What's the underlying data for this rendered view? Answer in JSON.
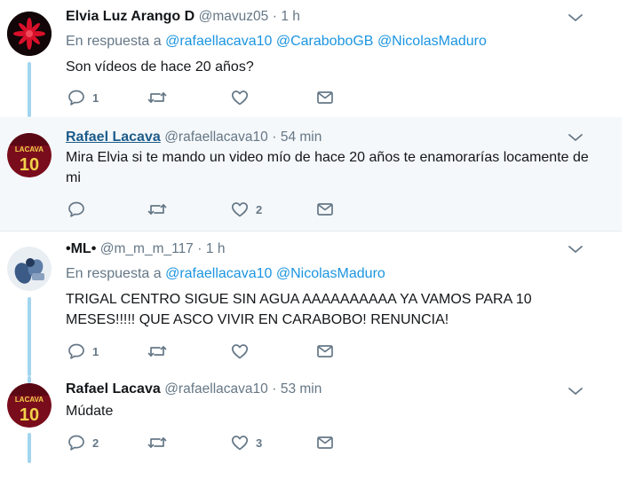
{
  "colors": {
    "mention": "#1b95e0",
    "muted": "#657786",
    "thread_line": "#a2d5ee",
    "highlight_bg": "#f5f8fa"
  },
  "tweets": [
    {
      "name": "Elvia Luz Arango D",
      "handle": "@mavuz05",
      "dot": "·",
      "time": "1 h",
      "reply_prefix": "En respuesta a",
      "mentions": [
        "@rafaellacava10",
        "@CaraboboGB",
        "@NicolasMaduro"
      ],
      "text": "Son vídeos de hace 20 años?",
      "reply_count": "1",
      "retweet_count": "",
      "like_count": "",
      "avatar_icon": "red-flower-avatar-icon"
    },
    {
      "name": "Rafael Lacava",
      "handle": "@rafaellacava10",
      "dot": "·",
      "time": "54 min",
      "text": "Mira Elvia si te mando un video mío de hace 20 años te enamorarías locamente de mi",
      "reply_count": "",
      "retweet_count": "",
      "like_count": "2",
      "avatar_jersey": {
        "label": "LACAVA",
        "number": "10"
      }
    },
    {
      "name": "•ML•",
      "handle": "@m_m_m_117",
      "dot": "·",
      "time": "1 h",
      "reply_prefix": "En respuesta a",
      "mentions": [
        "@rafaellacava10",
        "@NicolasMaduro"
      ],
      "text": "TRIGAL CENTRO SIGUE SIN AGUA AAAAAAAAAA YA VAMOS PARA 10 MESES!!!!! QUE ASCO VIVIR EN CARABOBO! RENUNCIA!",
      "reply_count": "1",
      "retweet_count": "",
      "like_count": "",
      "avatar_icon": "photo-avatar-icon"
    },
    {
      "name": "Rafael Lacava",
      "handle": "@rafaellacava10",
      "dot": "·",
      "time": "53 min",
      "text": "Múdate",
      "reply_count": "2",
      "retweet_count": "",
      "like_count": "3",
      "avatar_jersey": {
        "label": "LACAVA",
        "number": "10"
      }
    }
  ]
}
